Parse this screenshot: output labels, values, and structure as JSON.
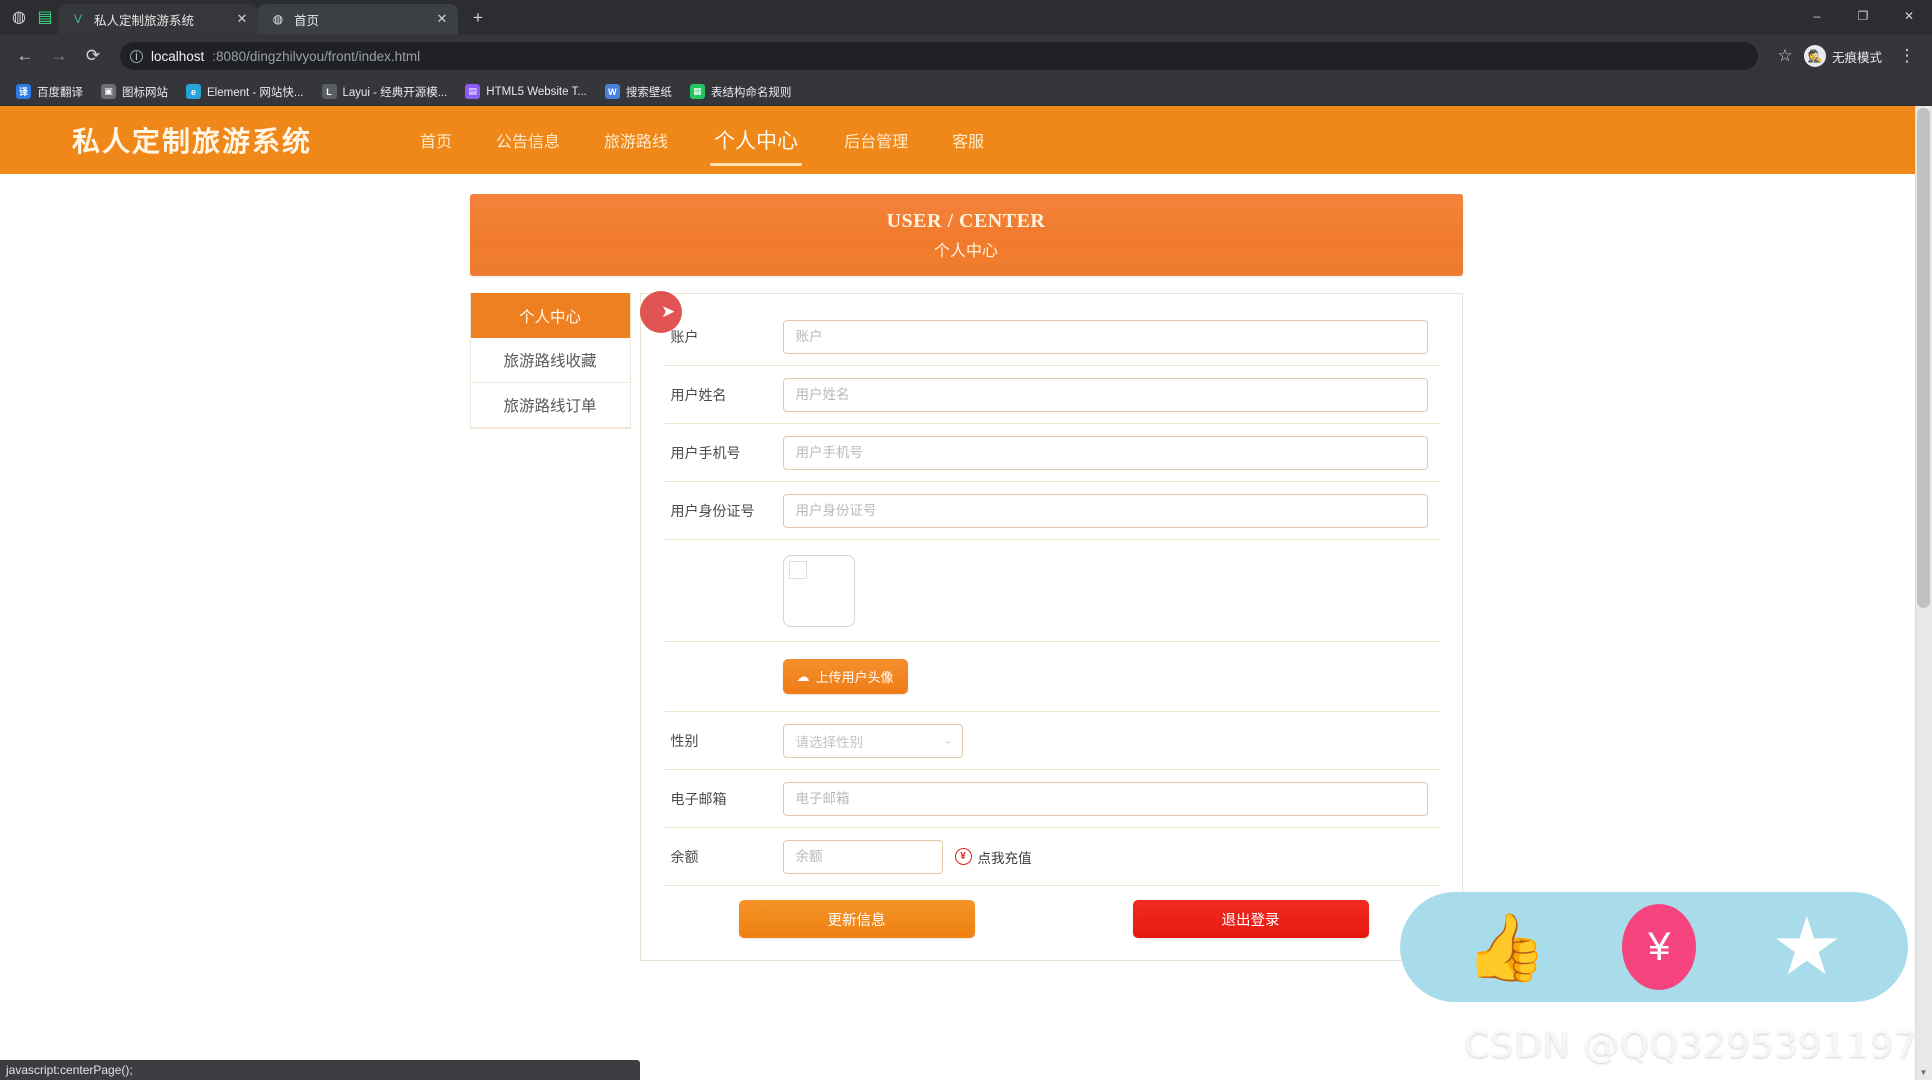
{
  "browser": {
    "tabs": [
      {
        "title": "私人定制旅游系统",
        "favicon": "V",
        "active": false
      },
      {
        "title": "首页",
        "favicon": "globe-icon",
        "active": true
      }
    ],
    "new_tab_label": "+",
    "window_controls": {
      "minimize": "–",
      "maximize": "❐",
      "close": "✕"
    },
    "nav": {
      "back": "←",
      "forward": "→",
      "reload": "⟳"
    },
    "address": {
      "info_icon": "ⓘ",
      "host": "localhost",
      "path": ":8080/dingzhilvyou/front/index.html",
      "full": "localhost:8080/dingzhilvyou/front/index.html"
    },
    "star_icon": "☆",
    "incognito_label": "无痕模式",
    "menu_icon": "⋮",
    "bookmarks": [
      {
        "label": "百度翻译",
        "icon_text": "译",
        "icon_color": "#2c7be5"
      },
      {
        "label": "图标网站",
        "icon_text": "▣",
        "icon_color": "#5f6368"
      },
      {
        "label": "Element - 网站快...",
        "icon_text": "e",
        "icon_color": "#2aa3d8"
      },
      {
        "label": "Layui - 经典开源模...",
        "icon_text": "L",
        "icon_color": "#4a4a4a"
      },
      {
        "label": "HTML5 Website T...",
        "icon_text": "▤",
        "icon_color": "#8b5cf6"
      },
      {
        "label": "搜索壁纸",
        "icon_text": "W",
        "icon_color": "#4a7fe0"
      },
      {
        "label": "表结构命名规则",
        "icon_text": "▦",
        "icon_color": "#22c55e"
      }
    ],
    "status_text": "javascript:centerPage();"
  },
  "site": {
    "brand": "私人定制旅游系统",
    "nav": [
      {
        "label": "首页",
        "active": false
      },
      {
        "label": "公告信息",
        "active": false
      },
      {
        "label": "旅游路线",
        "active": false
      },
      {
        "label": "个人中心",
        "active": true
      },
      {
        "label": "后台管理",
        "active": false
      },
      {
        "label": "客服",
        "active": false
      }
    ],
    "banner": {
      "en": "USER / CENTER",
      "cn": "个人中心"
    },
    "side_menu": [
      {
        "label": "个人中心",
        "active": true
      },
      {
        "label": "旅游路线收藏",
        "active": false
      },
      {
        "label": "旅游路线订单",
        "active": false
      }
    ]
  },
  "form": {
    "account": {
      "label": "账户",
      "value": "",
      "placeholder": "账户"
    },
    "username": {
      "label": "用户姓名",
      "value": "",
      "placeholder": "用户姓名"
    },
    "phone": {
      "label": "用户手机号",
      "value": "",
      "placeholder": "用户手机号"
    },
    "idcard": {
      "label": "用户身份证号",
      "value": "",
      "placeholder": "用户身份证号"
    },
    "avatar": {
      "label": "",
      "alt": "user-avatar-preview"
    },
    "upload": {
      "label": "上传用户头像",
      "icon": "cloud-upload-icon"
    },
    "gender": {
      "label": "性别",
      "placeholder": "请选择性别",
      "caret": "⌄"
    },
    "email": {
      "label": "电子邮箱",
      "value": "",
      "placeholder": "电子邮箱"
    },
    "balance": {
      "label": "余额",
      "value": "",
      "placeholder": "余额"
    },
    "recharge": {
      "label": "点我充值",
      "icon": "¥"
    },
    "submit": {
      "label": "更新信息"
    },
    "logout": {
      "label": "退出登录"
    }
  },
  "widget": {
    "icons": [
      "thumbs-up-icon",
      "coin-icon",
      "star-icon"
    ],
    "thumb_glyph": "👍",
    "coin_glyph": "¥",
    "star_glyph": "★",
    "watermark": "CSDN @QQ3295391197"
  },
  "colors": {
    "brand_orange": "#f08719",
    "banner_orange": "#ef7c2e",
    "logout_red": "#ee190f",
    "widget_blue": "#a9dceb",
    "widget_pink": "#f6447e",
    "field_border": "#e0cba8"
  }
}
